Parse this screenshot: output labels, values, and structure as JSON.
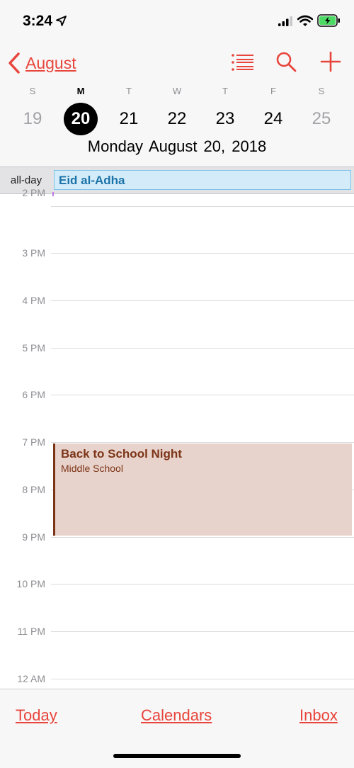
{
  "status_bar": {
    "time": "3:24",
    "icons": [
      "location-arrow-icon",
      "cellular-signal-icon",
      "wifi-icon",
      "battery-charging-icon"
    ]
  },
  "nav": {
    "back_label": "August",
    "icons": [
      "list-icon",
      "search-icon",
      "add-icon"
    ]
  },
  "week": {
    "letters": [
      "S",
      "M",
      "T",
      "W",
      "T",
      "F",
      "S"
    ],
    "days": [
      "19",
      "20",
      "21",
      "22",
      "23",
      "24",
      "25"
    ],
    "selected_index": 1
  },
  "date_title": "Monday  August 20, 2018",
  "all_day": {
    "label": "all-day",
    "event": "Eid al-Adha"
  },
  "hours": [
    "2 PM",
    "3 PM",
    "4 PM",
    "5 PM",
    "6 PM",
    "7 PM",
    "8 PM",
    "9 PM",
    "10 PM",
    "11 PM",
    "12 AM"
  ],
  "event": {
    "title": "Back to School Night",
    "subtitle": "Middle School"
  },
  "toolbar": {
    "today": "Today",
    "calendars": "Calendars",
    "inbox": "Inbox"
  },
  "colors": {
    "accent": "#e8453c",
    "selected_day": "#000000",
    "allday_event_fill": "#d4ecfa",
    "allday_event_text": "#1a73a8",
    "event_fill": "#e8d3cc",
    "event_text": "#7c3417"
  }
}
